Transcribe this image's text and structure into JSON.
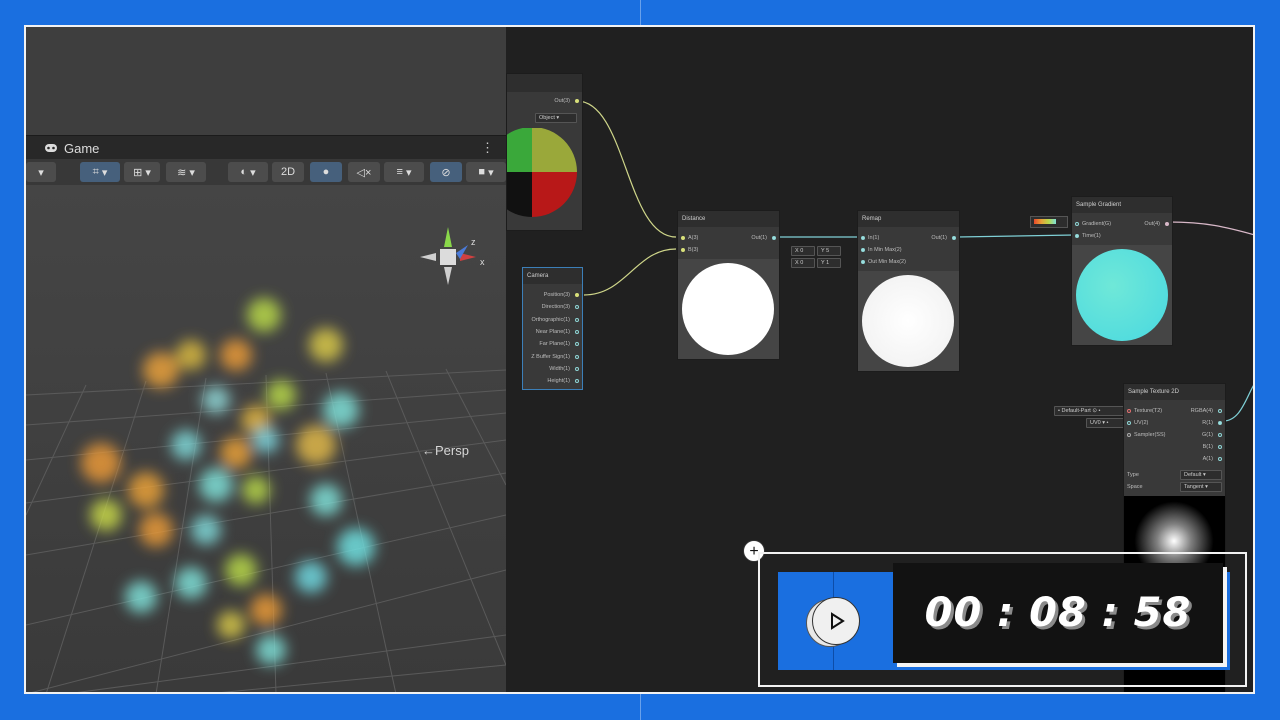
{
  "game_tab": {
    "label": "Game"
  },
  "toolbar": {
    "btn_2d": "2D"
  },
  "viewport": {
    "persp_label": "←Persp",
    "gizmo_z": "z",
    "gizmo_x": "x"
  },
  "nodes": {
    "position": {
      "out": "Out(3)",
      "space": "Object"
    },
    "camera": {
      "title": "Camera",
      "ports": [
        "Position(3)",
        "Direction(3)",
        "Orthographic(1)",
        "Near Plane(1)",
        "Far Plane(1)",
        "Z Buffer Sign(1)",
        "Width(1)",
        "Height(1)"
      ]
    },
    "distance": {
      "title": "Distance",
      "in_a": "A(3)",
      "in_b": "B(3)",
      "out": "Out(1)"
    },
    "remap": {
      "title": "Remap",
      "in": "In(1)",
      "in_min_max": "In Min Max(2)",
      "out_min_max": "Out Min Max(2)",
      "out": "Out(1)",
      "in_x_label": "X",
      "in_x": "0",
      "in_y_label": "Y",
      "in_y": "5",
      "out_x_label": "X",
      "out_x": "0",
      "out_y_label": "Y",
      "out_y": "1"
    },
    "sample_gradient": {
      "title": "Sample Gradient",
      "gradient": "Gradient(G)",
      "time": "Time(1)",
      "out": "Out(4)"
    },
    "sample_texture": {
      "title": "Sample Texture 2D",
      "texture": "Texture(T2)",
      "uv": "UV(2)",
      "sampler": "Sampler(SS)",
      "outs": [
        "RGBA(4)",
        "R(1)",
        "G(1)",
        "B(1)",
        "A(1)"
      ],
      "type_label": "Type",
      "type_value": "Default",
      "space_label": "Space",
      "space_value": "Tangent",
      "tex_chip": "Default-Part",
      "uv_chip": "UV0"
    }
  },
  "timer": {
    "time": "00 : 08 : 58",
    "plus": "+"
  },
  "colors": {
    "frame_blue": "#1a6fe0",
    "graph_bg": "#202020",
    "wire_yellow": "#cfd68a",
    "wire_cyan": "#7fd0d6"
  }
}
